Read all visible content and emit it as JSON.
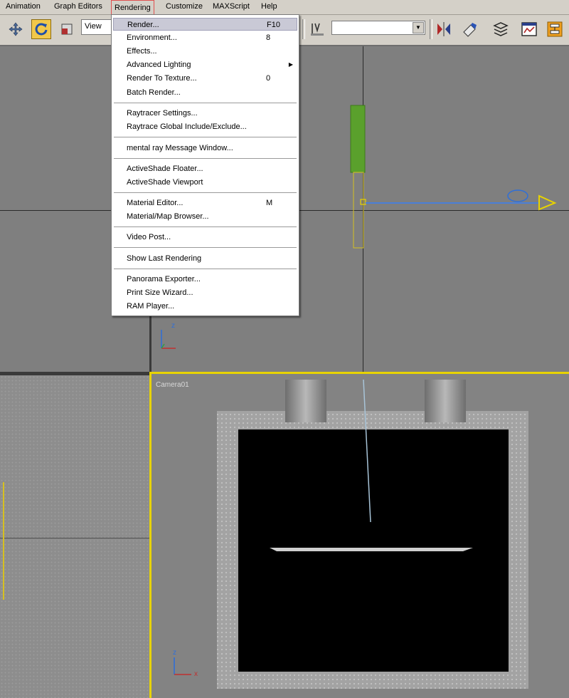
{
  "menubar": {
    "items": [
      {
        "label": "Animation"
      },
      {
        "label": "Graph Editors"
      },
      {
        "label": "Rendering"
      },
      {
        "label": "Customize"
      },
      {
        "label": "MAXScript"
      },
      {
        "label": "Help"
      }
    ]
  },
  "toolbar": {
    "reference_coord": "View",
    "named_selection": ""
  },
  "rendering_menu": {
    "items": [
      {
        "label": "Render...",
        "shortcut": "F10"
      },
      {
        "label": "Environment...",
        "shortcut": "8"
      },
      {
        "label": "Effects...",
        "shortcut": ""
      },
      {
        "label": "Advanced Lighting",
        "shortcut": ""
      },
      {
        "label": "Render To Texture...",
        "shortcut": "0"
      },
      {
        "label": "Batch Render...",
        "shortcut": ""
      },
      {
        "label": "Raytracer Settings...",
        "shortcut": ""
      },
      {
        "label": "Raytrace Global Include/Exclude...",
        "shortcut": ""
      },
      {
        "label": "mental ray Message Window...",
        "shortcut": ""
      },
      {
        "label": "ActiveShade Floater...",
        "shortcut": ""
      },
      {
        "label": "ActiveShade Viewport",
        "shortcut": ""
      },
      {
        "label": "Material Editor...",
        "shortcut": "M"
      },
      {
        "label": "Material/Map Browser...",
        "shortcut": ""
      },
      {
        "label": "Video Post...",
        "shortcut": ""
      },
      {
        "label": "Show Last Rendering",
        "shortcut": ""
      },
      {
        "label": "Panorama Exporter...",
        "shortcut": ""
      },
      {
        "label": "Print Size Wizard...",
        "shortcut": ""
      },
      {
        "label": "RAM Player...",
        "shortcut": ""
      }
    ]
  },
  "viewports": {
    "camera_label": "Camera01",
    "axis_x": "x",
    "axis_z": "z"
  },
  "colors": {
    "active_viewport_border": "#e8d300",
    "light_gizmo": "#2f6fd8",
    "selected_object": "#5aa02c",
    "target_marker": "#e8d300"
  }
}
